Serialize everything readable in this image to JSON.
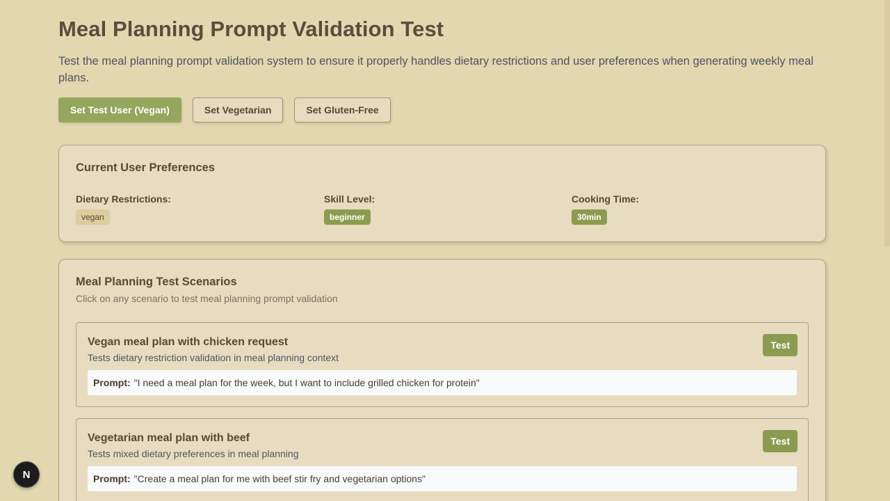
{
  "page": {
    "title": "Meal Planning Prompt Validation Test",
    "intro": "Test the meal planning prompt validation system to ensure it properly handles dietary restrictions and user preferences when generating weekly meal plans."
  },
  "actions": {
    "set_vegan_label": "Set Test User (Vegan)",
    "set_vegetarian_label": "Set Vegetarian",
    "set_gluten_free_label": "Set Gluten-Free"
  },
  "preferences": {
    "title": "Current User Preferences",
    "dietary_label": "Dietary Restrictions:",
    "dietary_value": "vegan",
    "skill_label": "Skill Level:",
    "skill_value": "beginner",
    "time_label": "Cooking Time:",
    "time_value": "30min"
  },
  "scenarios": {
    "title": "Meal Planning Test Scenarios",
    "subtitle": "Click on any scenario to test meal planning prompt validation",
    "prompt_label": "Prompt:",
    "test_label": "Test",
    "items": [
      {
        "title": "Vegan meal plan with chicken request",
        "description": "Tests dietary restriction validation in meal planning context",
        "prompt": "\"I need a meal plan for the week, but I want to include grilled chicken for protein\""
      },
      {
        "title": "Vegetarian meal plan with beef",
        "description": "Tests mixed dietary preferences in meal planning",
        "prompt": "\"Create a meal plan for me with beef stir fry and vegetarian options\""
      }
    ]
  },
  "dev_badge": {
    "letter": "N",
    "icon": "nextjs-logo-icon"
  },
  "colors": {
    "background": "#e3d7b0",
    "primary_green": "#94a75c",
    "tag_green": "#8b9b4f",
    "card_background": "#e7dcc0",
    "text_brown": "#5a4636"
  }
}
